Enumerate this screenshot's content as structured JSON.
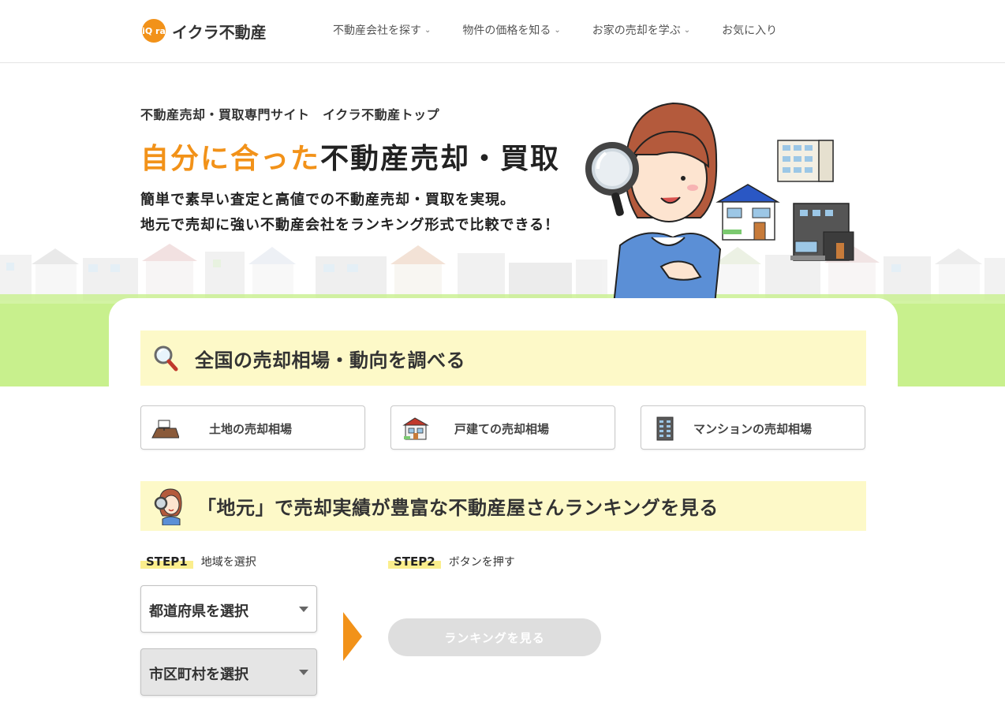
{
  "header": {
    "logo_mark": "iQ ra",
    "logo_text": "イクラ不動産",
    "nav": [
      {
        "label": "不動産会社を探す",
        "has_dropdown": true
      },
      {
        "label": "物件の価格を知る",
        "has_dropdown": true
      },
      {
        "label": "お家の売却を学ぶ",
        "has_dropdown": true
      },
      {
        "label": "お気に入り",
        "has_dropdown": false
      }
    ],
    "chevron": "⌄"
  },
  "hero": {
    "subtitle": "不動産売却・買取専門サイト　イクラ不動産トップ",
    "title_accent": "自分に合った",
    "title_rest": "不動産売却・買取",
    "desc_line1": "簡単で素早い査定と高値での不動産売却・買取を実現。",
    "desc_line2": "地元で売却に強い不動産会社をランキング形式で比較できる！"
  },
  "market": {
    "title": "全国の売却相場・動向を調べる",
    "icon": "magnifier-icon",
    "tiles": [
      {
        "label": "土地の売却相場",
        "icon": "land-icon"
      },
      {
        "label": "戸建ての売却相場",
        "icon": "house-icon"
      },
      {
        "label": "マンションの売却相場",
        "icon": "apartment-icon"
      }
    ]
  },
  "ranking": {
    "title": "「地元」で売却実績が豊富な不動産屋さんランキングを見る",
    "icon": "woman-magnifier-icon",
    "step1": {
      "badge": "STEP1",
      "text": "地域を選択"
    },
    "step2": {
      "badge": "STEP2",
      "text": "ボタンを押す"
    },
    "prefecture_select": "都道府県を選択",
    "city_select": "市区町村を選択",
    "button": "ランキングを見る"
  },
  "colors": {
    "accent": "#f29219",
    "band": "#fdf9c8",
    "grass": "#c8f08d",
    "disabled_button": "#dedede"
  }
}
